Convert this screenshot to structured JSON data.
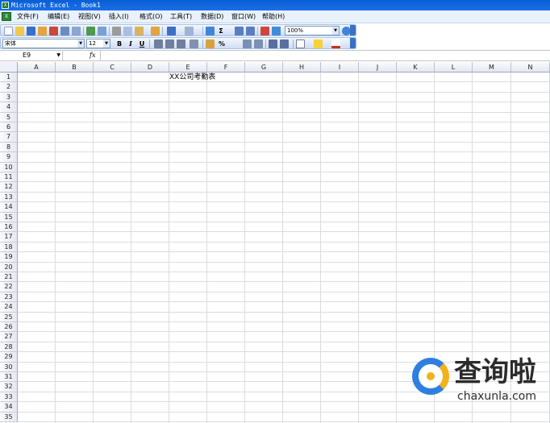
{
  "window": {
    "title": "Microsoft Excel - Book1",
    "app_icon": "excel-icon"
  },
  "menu": {
    "items": [
      {
        "label": "文件(F)"
      },
      {
        "label": "编辑(E)"
      },
      {
        "label": "视图(V)"
      },
      {
        "label": "插入(I)"
      },
      {
        "label": "格式(O)"
      },
      {
        "label": "工具(T)"
      },
      {
        "label": "数据(D)"
      },
      {
        "label": "窗口(W)"
      },
      {
        "label": "帮助(H)"
      }
    ]
  },
  "toolbar1": {
    "zoom": "100%"
  },
  "toolbar2": {
    "font_name": "宋体",
    "font_size": "12",
    "bold": "B",
    "italic": "I",
    "underline": "U",
    "percent": "%"
  },
  "formula_bar": {
    "name_box": "E9",
    "fx": "fx",
    "value": ""
  },
  "sheet": {
    "columns": [
      "A",
      "B",
      "C",
      "D",
      "E",
      "F",
      "G",
      "H",
      "I",
      "J",
      "K",
      "L",
      "M",
      "N"
    ],
    "rows": [
      "1",
      "2",
      "3",
      "4",
      "5",
      "6",
      "7",
      "8",
      "9",
      "10",
      "11",
      "12",
      "13",
      "14",
      "15",
      "16",
      "17",
      "18",
      "19",
      "20",
      "21",
      "22",
      "23",
      "24",
      "25",
      "26",
      "27",
      "28",
      "29",
      "30",
      "31",
      "32",
      "33",
      "34",
      "35"
    ],
    "cells": {
      "E1": "XX公司考勤表"
    }
  },
  "watermark": {
    "cn": "查询啦",
    "en": "chaxunla.com"
  },
  "colors": {
    "title_bar": "#0a5fd6",
    "toolbar_bg": "#cfddf3",
    "grid_line": "#dadcdd",
    "header_bg": "#e4e8f0"
  }
}
